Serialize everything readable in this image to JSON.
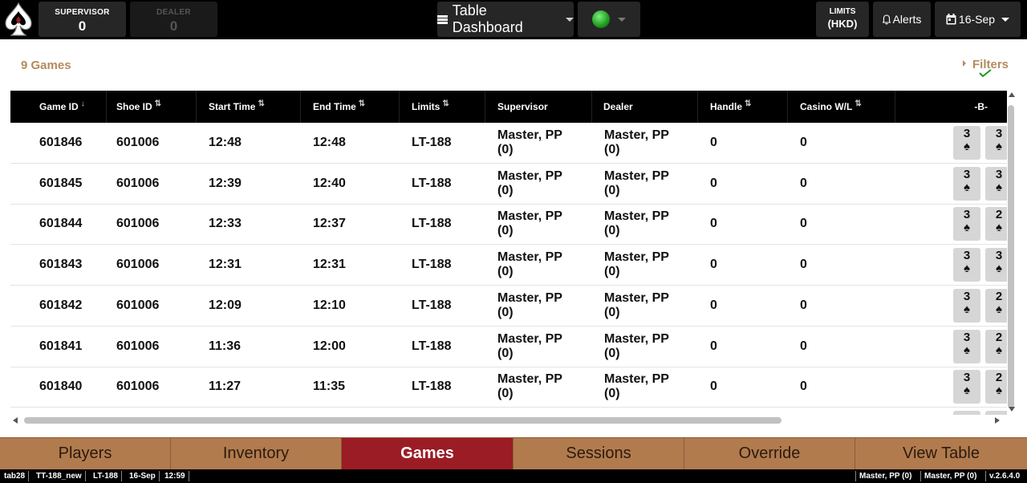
{
  "header": {
    "supervisor": {
      "label": "SUPERVISOR",
      "value": "0"
    },
    "dealer": {
      "label": "DEALER",
      "value": "0"
    },
    "dashboard_label": "Table Dashboard",
    "limits_line1": "LIMITS",
    "limits_line2": "(HKD)",
    "alerts_label": "Alerts",
    "date_label": "16-Sep",
    "status_color": "#1e9a1e"
  },
  "content": {
    "games_count": "9 Games",
    "filters_label": "Filters"
  },
  "table": {
    "columns": [
      {
        "label": "Game ID",
        "sort": "↓"
      },
      {
        "label": "Shoe ID",
        "sort": "⇅"
      },
      {
        "label": "Start Time",
        "sort": "⇅"
      },
      {
        "label": "End Time",
        "sort": "⇅"
      },
      {
        "label": "Limits",
        "sort": "⇅"
      },
      {
        "label": "Supervisor",
        "sort": ""
      },
      {
        "label": "Dealer",
        "sort": ""
      },
      {
        "label": "Handle",
        "sort": "⇅"
      },
      {
        "label": "Casino W/L",
        "sort": "⇅"
      },
      {
        "label": "-B-",
        "sort": ""
      }
    ],
    "rows": [
      {
        "game_id": "601846",
        "shoe_id": "601006",
        "start": "12:48",
        "end": "12:48",
        "limits": "LT-188",
        "supervisor": "Master, PP",
        "supervisor_sub": "(0)",
        "dealer": "Master, PP",
        "dealer_sub": "(0)",
        "handle": "0",
        "casino_wl": "0",
        "card1": "3",
        "card2": "3"
      },
      {
        "game_id": "601845",
        "shoe_id": "601006",
        "start": "12:39",
        "end": "12:40",
        "limits": "LT-188",
        "supervisor": "Master, PP",
        "supervisor_sub": "(0)",
        "dealer": "Master, PP",
        "dealer_sub": "(0)",
        "handle": "0",
        "casino_wl": "0",
        "card1": "3",
        "card2": "3"
      },
      {
        "game_id": "601844",
        "shoe_id": "601006",
        "start": "12:33",
        "end": "12:37",
        "limits": "LT-188",
        "supervisor": "Master, PP",
        "supervisor_sub": "(0)",
        "dealer": "Master, PP",
        "dealer_sub": "(0)",
        "handle": "0",
        "casino_wl": "0",
        "card1": "3",
        "card2": "2"
      },
      {
        "game_id": "601843",
        "shoe_id": "601006",
        "start": "12:31",
        "end": "12:31",
        "limits": "LT-188",
        "supervisor": "Master, PP",
        "supervisor_sub": "(0)",
        "dealer": "Master, PP",
        "dealer_sub": "(0)",
        "handle": "0",
        "casino_wl": "0",
        "card1": "3",
        "card2": "3"
      },
      {
        "game_id": "601842",
        "shoe_id": "601006",
        "start": "12:09",
        "end": "12:10",
        "limits": "LT-188",
        "supervisor": "Master, PP",
        "supervisor_sub": "(0)",
        "dealer": "Master, PP",
        "dealer_sub": "(0)",
        "handle": "0",
        "casino_wl": "0",
        "card1": "3",
        "card2": "2"
      },
      {
        "game_id": "601841",
        "shoe_id": "601006",
        "start": "11:36",
        "end": "12:00",
        "limits": "LT-188",
        "supervisor": "Master, PP",
        "supervisor_sub": "(0)",
        "dealer": "Master, PP",
        "dealer_sub": "(0)",
        "handle": "0",
        "casino_wl": "0",
        "card1": "3",
        "card2": "2"
      },
      {
        "game_id": "601840",
        "shoe_id": "601006",
        "start": "11:27",
        "end": "11:35",
        "limits": "LT-188",
        "supervisor": "Master, PP",
        "supervisor_sub": "(0)",
        "dealer": "Master, PP",
        "dealer_sub": "(0)",
        "handle": "0",
        "casino_wl": "0",
        "card1": "3",
        "card2": "2"
      }
    ],
    "card_suit": "♠"
  },
  "tabs": [
    {
      "label": "Players"
    },
    {
      "label": "Inventory"
    },
    {
      "label": "Games",
      "active": true
    },
    {
      "label": "Sessions"
    },
    {
      "label": "Override"
    },
    {
      "label": "View Table"
    }
  ],
  "statusbar": {
    "left": [
      "tab28",
      "TT-188_new",
      "LT-188",
      "16-Sep",
      "12:59"
    ],
    "right": [
      "Master, PP (0)",
      "Master, PP (0)",
      "v.2.6.4.0"
    ]
  },
  "colors": {
    "accent_tan": "#b38b5d",
    "tab_bar": "#b17b4e",
    "tab_active": "#9b1c24"
  }
}
